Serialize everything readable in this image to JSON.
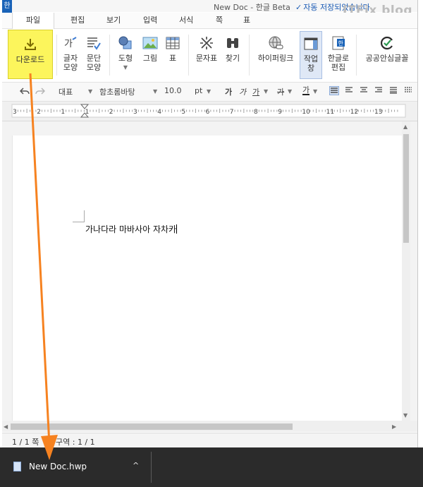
{
  "title": {
    "app_icon": "한",
    "window_title": "New Doc - 한글 Beta",
    "autosave_check": "✓",
    "autosave_text": "자동 저장되었습니다",
    "watermark": "ITFix blog"
  },
  "menu": [
    "파일",
    "편집",
    "보기",
    "입력",
    "서식",
    "쪽",
    "표"
  ],
  "ribbon": {
    "download": "다운로드",
    "char_shape": [
      "글자",
      "모양"
    ],
    "para_shape": [
      "문단",
      "모양"
    ],
    "shape": "도형",
    "picture": "그림",
    "table": "표",
    "symbols": "문자표",
    "find": "찾기",
    "hyperlink": "하이퍼링크",
    "task_pane": [
      "작업",
      "창"
    ],
    "hangul_edit": [
      "한글로",
      "편집"
    ],
    "public_font": "공공안심글꼴"
  },
  "format": {
    "style": "대표",
    "font": "함초롬바탕",
    "size": "10.0",
    "unit": "pt",
    "bold": "가",
    "italic": "가",
    "underline": "가",
    "strike": "가",
    "color": "가"
  },
  "ruler_numbers": [
    "3",
    "2",
    "1",
    "1",
    "2",
    "3",
    "4",
    "5",
    "6",
    "7",
    "8",
    "9",
    "10",
    "11",
    "12",
    "13"
  ],
  "document": {
    "text": "가나다라 마바사아 자차카"
  },
  "status": {
    "page": "1 / 1 쪽",
    "section": "구역 : 1 / 1"
  },
  "download_bar": {
    "filename": "New Doc.hwp",
    "chevron": "^"
  },
  "colors": {
    "accent_blue": "#1a63b8",
    "download_highlight": "#fcf55c",
    "annotation_arrow": "#f68220",
    "download_bar_bg": "#2b2b2b"
  }
}
